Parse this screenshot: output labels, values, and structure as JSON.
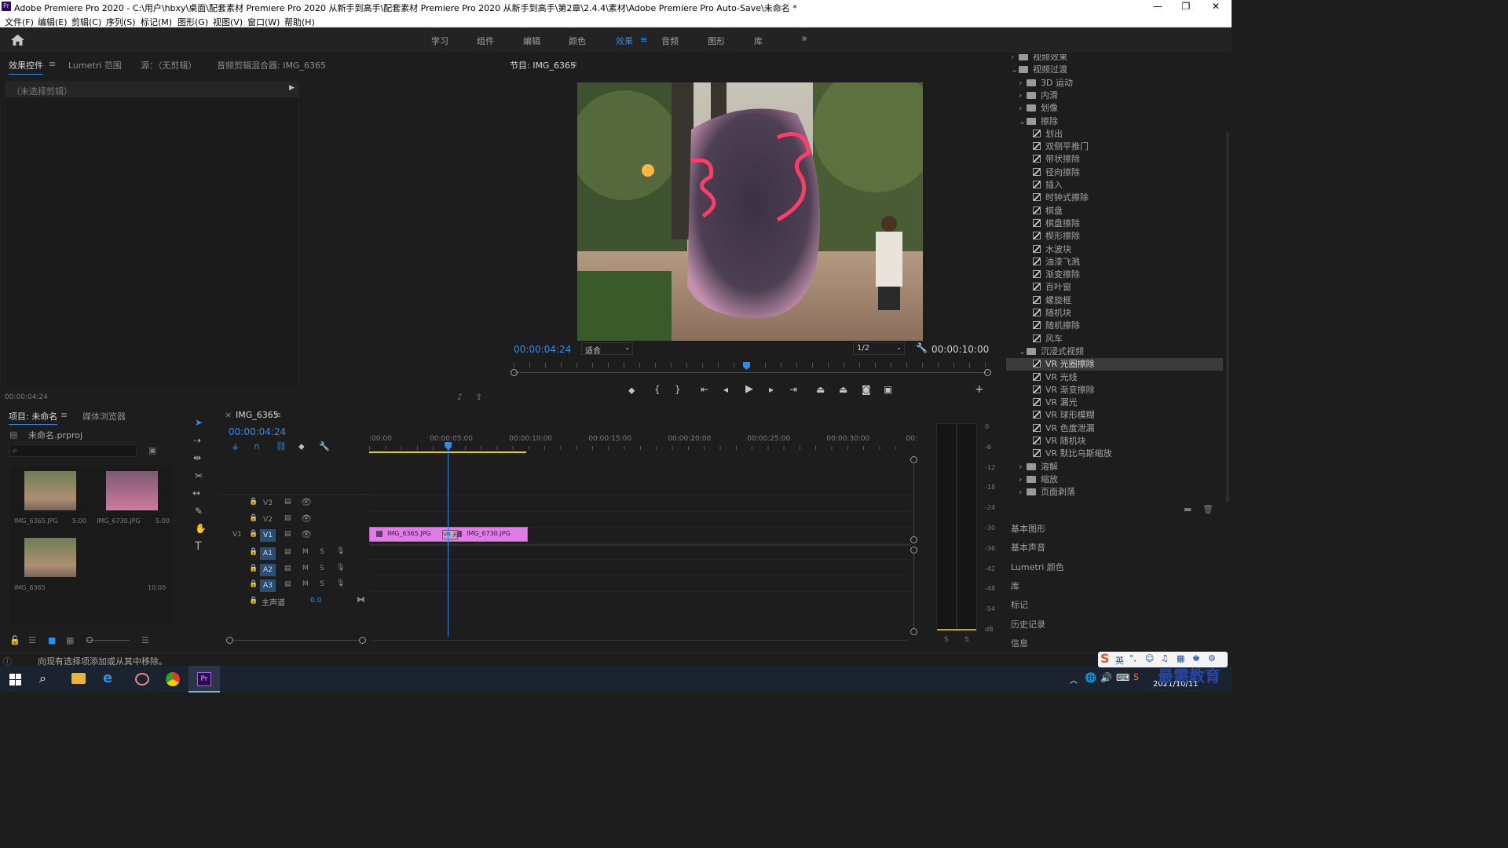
{
  "window": {
    "title": "Adobe Premiere Pro 2020 - C:\\用户\\hbxy\\桌面\\配套素材 Premiere Pro 2020 从新手到高手\\配套素材 Premiere Pro 2020 从新手到高手\\第2章\\2.4.4\\素材\\Adobe Premiere Pro Auto-Save\\未命名 *",
    "app_icon": "Pr",
    "controls": {
      "minimize": "—",
      "restore": "❐",
      "close": "✕"
    }
  },
  "menu": [
    "文件(F)",
    "编辑(E)",
    "剪辑(C)",
    "序列(S)",
    "标记(M)",
    "图形(G)",
    "视图(V)",
    "窗口(W)",
    "帮助(H)"
  ],
  "workspaces": {
    "items": [
      "学习",
      "组件",
      "编辑",
      "颜色",
      "效果",
      "音频",
      "图形",
      "库"
    ],
    "active": "效果",
    "more": "»"
  },
  "effect_controls": {
    "tabs": [
      "效果控件",
      "Lumetri 范围",
      "源：（无剪辑）",
      "音频剪辑混合器: IMG_6365"
    ],
    "no_clip": "（未选择剪辑）",
    "timecode": "00:00:04:24"
  },
  "program_monitor": {
    "title": "节目: IMG_6365",
    "timecode": "00:00:04:24",
    "fit": "适合",
    "resolution": "1/2",
    "duration": "00:00:10:00",
    "playhead_fraction": 0.49
  },
  "project": {
    "tabs": [
      "项目: 未命名",
      "媒体浏览器"
    ],
    "file": "未命名.prproj",
    "search_placeholder": "",
    "items": [
      {
        "name": "IMG_6365.JPG",
        "duration": "5:00"
      },
      {
        "name": "IMG_6730.JPG",
        "duration": "5:00"
      },
      {
        "name": "IMG_6365",
        "duration": "10:00"
      }
    ]
  },
  "timeline": {
    "sequence": "IMG_6365",
    "timecode": "00:00:04:24",
    "ruler": [
      ":00:00",
      "00:00:05:00",
      "00:00:10:00",
      "00:00:15:00",
      "00:00:20:00",
      "00:00:25:00",
      "00:00:30:00",
      "00:"
    ],
    "video_tracks": [
      "V3",
      "V2",
      "V1"
    ],
    "audio_tracks": [
      "A1",
      "A2",
      "A3"
    ],
    "master": {
      "label": "主声道",
      "value": "0.0"
    },
    "source_patch": "V1",
    "clips": [
      {
        "name": "IMG_6365.JPG",
        "track": "V1",
        "start": 0,
        "end": 5
      },
      {
        "name": "IMG_6730.JPG",
        "track": "V1",
        "start": 5,
        "end": 10
      }
    ],
    "transition_label": "VR 光",
    "playhead_time": 4.96,
    "visible_seconds": 34
  },
  "audio_meter": {
    "scale": [
      "0",
      "-6",
      "-12",
      "-18",
      "-24",
      "-30",
      "-36",
      "-42",
      "-48",
      "-54",
      "dB"
    ],
    "solo": [
      "S",
      "S"
    ]
  },
  "effects_tree": [
    {
      "label": "视频效果",
      "type": "folder",
      "level": 0,
      "state": "collapsed"
    },
    {
      "label": "视频过渡",
      "type": "folder",
      "level": 0,
      "state": "expanded"
    },
    {
      "label": "3D 运动",
      "type": "folder",
      "level": 1,
      "state": "collapsed"
    },
    {
      "label": "内滑",
      "type": "folder",
      "level": 1,
      "state": "collapsed"
    },
    {
      "label": "划像",
      "type": "folder",
      "level": 1,
      "state": "collapsed"
    },
    {
      "label": "擦除",
      "type": "folder",
      "level": 1,
      "state": "expanded"
    },
    {
      "label": "划出",
      "type": "effect",
      "level": 2
    },
    {
      "label": "双侧平推门",
      "type": "effect",
      "level": 2
    },
    {
      "label": "带状擦除",
      "type": "effect",
      "level": 2
    },
    {
      "label": "径向擦除",
      "type": "effect",
      "level": 2
    },
    {
      "label": "插入",
      "type": "effect",
      "level": 2
    },
    {
      "label": "时钟式擦除",
      "type": "effect",
      "level": 2
    },
    {
      "label": "棋盘",
      "type": "effect",
      "level": 2
    },
    {
      "label": "棋盘擦除",
      "type": "effect",
      "level": 2
    },
    {
      "label": "楔形擦除",
      "type": "effect",
      "level": 2
    },
    {
      "label": "水波块",
      "type": "effect",
      "level": 2
    },
    {
      "label": "油漆飞溅",
      "type": "effect",
      "level": 2
    },
    {
      "label": "渐变擦除",
      "type": "effect",
      "level": 2
    },
    {
      "label": "百叶窗",
      "type": "effect",
      "level": 2
    },
    {
      "label": "螺旋框",
      "type": "effect",
      "level": 2
    },
    {
      "label": "随机块",
      "type": "effect",
      "level": 2
    },
    {
      "label": "随机擦除",
      "type": "effect",
      "level": 2
    },
    {
      "label": "风车",
      "type": "effect",
      "level": 2
    },
    {
      "label": "沉浸式视频",
      "type": "folder",
      "level": 1,
      "state": "expanded"
    },
    {
      "label": "VR 光圈擦除",
      "type": "effect",
      "level": 2,
      "selected": true
    },
    {
      "label": "VR 光线",
      "type": "effect",
      "level": 2
    },
    {
      "label": "VR 渐变擦除",
      "type": "effect",
      "level": 2
    },
    {
      "label": "VR 漏光",
      "type": "effect",
      "level": 2
    },
    {
      "label": "VR 球形模糊",
      "type": "effect",
      "level": 2
    },
    {
      "label": "VR 色度泄漏",
      "type": "effect",
      "level": 2
    },
    {
      "label": "VR 随机块",
      "type": "effect",
      "level": 2
    },
    {
      "label": "VR 默比乌斯缩放",
      "type": "effect",
      "level": 2
    },
    {
      "label": "溶解",
      "type": "folder",
      "level": 1,
      "state": "collapsed"
    },
    {
      "label": "缩放",
      "type": "folder",
      "level": 1,
      "state": "collapsed"
    },
    {
      "label": "页面剥落",
      "type": "folder",
      "level": 1,
      "state": "collapsed"
    }
  ],
  "side_panels": [
    "基本图形",
    "基本声音",
    "Lumetri 颜色",
    "库",
    "标记",
    "历史记录",
    "信息"
  ],
  "status": "向现有选择项添加或从其中移除。",
  "taskbar": {
    "ime": "英",
    "date": "2021/10/11",
    "watermark": "最需教育"
  },
  "colors": {
    "accent": "#2d8ceb",
    "clip": "#e17be6",
    "clip_dark": "#c45bc9",
    "patch": "#2a4f72",
    "in_out": "#e6d400"
  }
}
